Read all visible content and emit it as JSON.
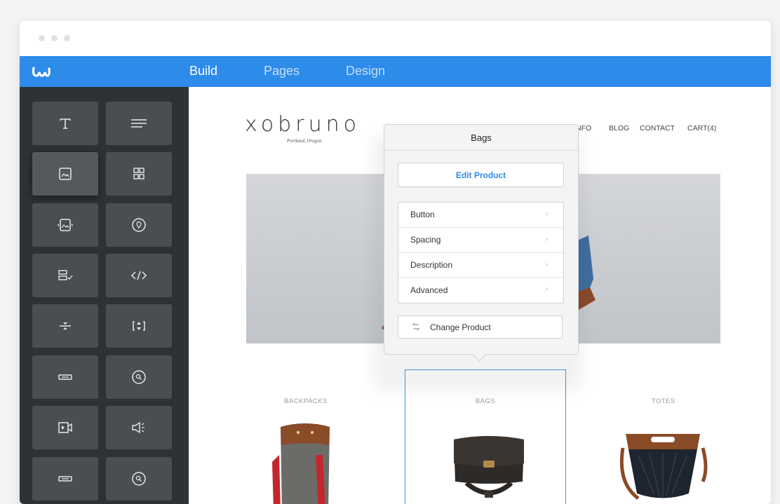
{
  "topnav": {
    "tabs": [
      {
        "label": "Build",
        "active": true
      },
      {
        "label": "Pages",
        "active": false
      },
      {
        "label": "Design",
        "active": false
      }
    ]
  },
  "sidebar": {
    "tiles": [
      {
        "icon": "title-icon"
      },
      {
        "icon": "text-icon"
      },
      {
        "icon": "image-icon"
      },
      {
        "icon": "gallery-icon"
      },
      {
        "icon": "slideshow-icon"
      },
      {
        "icon": "map-icon"
      },
      {
        "icon": "form-icon"
      },
      {
        "icon": "embed-code-icon"
      },
      {
        "icon": "divider-icon"
      },
      {
        "icon": "spacer-icon"
      },
      {
        "icon": "button-icon"
      },
      {
        "icon": "search-icon"
      },
      {
        "icon": "video-icon"
      },
      {
        "icon": "audio-icon"
      },
      {
        "icon": "button-icon"
      },
      {
        "icon": "search-icon"
      }
    ]
  },
  "site": {
    "brand": "xobruno",
    "brand_sub": "Portland, Oregon",
    "nav": [
      "NFO",
      "BLOG",
      "CONTACT",
      "CART(4)"
    ],
    "categories": [
      "BACKPACKS",
      "BAGS",
      "TOTES"
    ]
  },
  "popup": {
    "title": "Bags",
    "edit_label": "Edit Product",
    "options": [
      "Button",
      "Spacing",
      "Description",
      "Advanced"
    ],
    "chevron": "›",
    "change_label": "Change Product"
  },
  "colors": {
    "accent": "#2d8bea",
    "sidebar_bg": "#2f3234",
    "tile_bg": "#4a4e51"
  }
}
